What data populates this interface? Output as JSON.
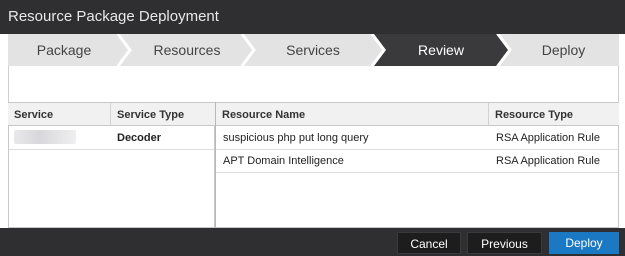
{
  "window": {
    "title": "Resource Package Deployment"
  },
  "wizard": {
    "steps": [
      {
        "label": "Package",
        "active": false
      },
      {
        "label": "Resources",
        "active": false
      },
      {
        "label": "Services",
        "active": false
      },
      {
        "label": "Review",
        "active": true
      },
      {
        "label": "Deploy",
        "active": false
      }
    ],
    "colors": {
      "inactive": "#e3e3e3",
      "active": "#3a3a3c",
      "separator": "#ffffff"
    }
  },
  "services_table": {
    "headers": {
      "service": "Service",
      "service_type": "Service Type"
    },
    "rows": [
      {
        "service": "",
        "service_type": "Decoder"
      }
    ]
  },
  "resources_table": {
    "headers": {
      "resource_name": "Resource Name",
      "resource_type": "Resource Type"
    },
    "rows": [
      {
        "resource_name": "suspicious php put long query",
        "resource_type": "RSA Application Rule"
      },
      {
        "resource_name": "APT Domain Intelligence",
        "resource_type": "RSA Application Rule"
      }
    ]
  },
  "footer": {
    "cancel_label": "Cancel",
    "previous_label": "Previous",
    "deploy_label": "Deploy",
    "accent": "#1b79c4"
  }
}
